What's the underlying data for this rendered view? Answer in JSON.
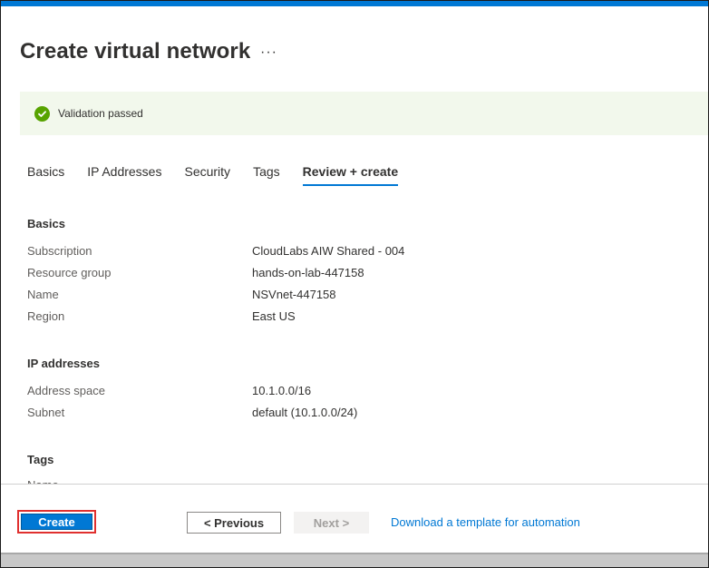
{
  "header": {
    "title": "Create virtual network",
    "more_label": "···"
  },
  "validation": {
    "message": "Validation passed",
    "status_color": "#57a300",
    "icon": "check-circle-icon"
  },
  "tabs": [
    {
      "label": "Basics",
      "active": false
    },
    {
      "label": "IP Addresses",
      "active": false
    },
    {
      "label": "Security",
      "active": false
    },
    {
      "label": "Tags",
      "active": false
    },
    {
      "label": "Review + create",
      "active": true
    }
  ],
  "sections": {
    "basics": {
      "heading": "Basics",
      "rows": [
        {
          "label": "Subscription",
          "value": "CloudLabs AIW Shared - 004"
        },
        {
          "label": "Resource group",
          "value": "hands-on-lab-447158"
        },
        {
          "label": "Name",
          "value": "NSVnet-447158"
        },
        {
          "label": "Region",
          "value": "East US"
        }
      ]
    },
    "ip_addresses": {
      "heading": "IP addresses",
      "rows": [
        {
          "label": "Address space",
          "value": "10.1.0.0/16"
        },
        {
          "label": "Subnet",
          "value": "default (10.1.0.0/24)"
        }
      ]
    },
    "tags": {
      "heading": "Tags",
      "cutoff_text": "Name"
    }
  },
  "footer": {
    "create_label": "Create",
    "previous_label": "< Previous",
    "next_label": "Next >",
    "download_label": "Download a template for automation"
  },
  "colors": {
    "accent": "#0078d4",
    "highlight_box": "#e0302f",
    "validation_bg": "#f2f8ec"
  }
}
